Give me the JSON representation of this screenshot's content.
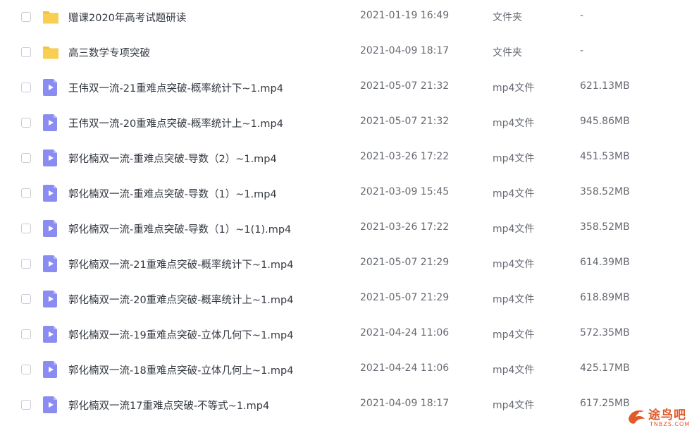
{
  "files": [
    {
      "name": "赠课2020年高考试题研读",
      "date": "2021-01-19 16:49",
      "type": "文件夹",
      "size": "-",
      "icon": "folder-icon"
    },
    {
      "name": "高三数学专项突破",
      "date": "2021-04-09 18:17",
      "type": "文件夹",
      "size": "-",
      "icon": "folder-icon"
    },
    {
      "name": "王伟双一流-21重难点突破-概率统计下~1.mp4",
      "date": "2021-05-07 21:32",
      "type": "mp4文件",
      "size": "621.13MB",
      "icon": "video-file-icon"
    },
    {
      "name": "王伟双一流-20重难点突破-概率统计上~1.mp4",
      "date": "2021-05-07 21:32",
      "type": "mp4文件",
      "size": "945.86MB",
      "icon": "video-file-icon"
    },
    {
      "name": "郭化楠双一流-重难点突破-导数（2）~1.mp4",
      "date": "2021-03-26 17:22",
      "type": "mp4文件",
      "size": "451.53MB",
      "icon": "video-file-icon"
    },
    {
      "name": "郭化楠双一流-重难点突破-导数（1）~1.mp4",
      "date": "2021-03-09 15:45",
      "type": "mp4文件",
      "size": "358.52MB",
      "icon": "video-file-icon"
    },
    {
      "name": "郭化楠双一流-重难点突破-导数（1）~1(1).mp4",
      "date": "2021-03-26 17:22",
      "type": "mp4文件",
      "size": "358.52MB",
      "icon": "video-file-icon"
    },
    {
      "name": "郭化楠双一流-21重难点突破-概率统计下~1.mp4",
      "date": "2021-05-07 21:29",
      "type": "mp4文件",
      "size": "614.39MB",
      "icon": "video-file-icon"
    },
    {
      "name": "郭化楠双一流-20重难点突破-概率统计上~1.mp4",
      "date": "2021-05-07 21:29",
      "type": "mp4文件",
      "size": "618.89MB",
      "icon": "video-file-icon"
    },
    {
      "name": "郭化楠双一流-19重难点突破-立体几何下~1.mp4",
      "date": "2021-04-24 11:06",
      "type": "mp4文件",
      "size": "572.35MB",
      "icon": "video-file-icon"
    },
    {
      "name": "郭化楠双一流-18重难点突破-立体几何上~1.mp4",
      "date": "2021-04-24 11:06",
      "type": "mp4文件",
      "size": "425.17MB",
      "icon": "video-file-icon"
    },
    {
      "name": "郭化楠双一流17重难点突破-不等式~1.mp4",
      "date": "2021-04-09 18:17",
      "type": "mp4文件",
      "size": "617.25MB",
      "icon": "video-file-icon"
    }
  ],
  "watermark": {
    "text": "途鸟吧",
    "sub": "TNBZS.COM"
  },
  "colors": {
    "folder": "#f5c33b",
    "video_file": "#8a8cf2",
    "watermark": "#e05a2a"
  }
}
